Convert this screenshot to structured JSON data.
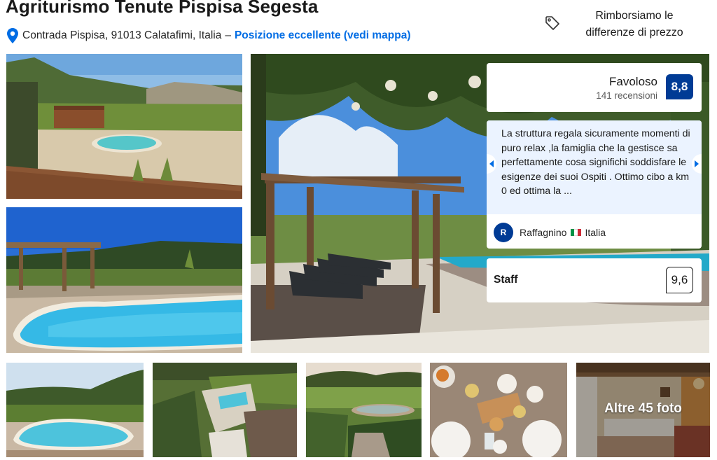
{
  "header": {
    "title": "Agriturismo Tenute Pispisa Segesta",
    "address": "Contrada Pispisa, 91013 Calatafimi, Italia",
    "separator": "–",
    "location_link": "Posizione eccellente (vedi mappa)"
  },
  "price_match": {
    "icon": "tag-icon",
    "text": "Rimborsiamo le differenze di prezzo"
  },
  "gallery": {
    "more_photos_label": "Altre 45 foto"
  },
  "rating": {
    "word": "Favoloso",
    "review_count": "141 recensioni",
    "score": "8,8"
  },
  "review": {
    "text": "La struttura regala sicuramente momenti di puro relax ,la famiglia che la gestisce sa perfettamente cosa significhi soddisfare le esigenze dei suoi Ospiti . Ottimo cibo a km 0 ed ottima la ...",
    "author_initial": "R",
    "author": "Raffagnino",
    "country": "Italia"
  },
  "staff": {
    "label": "Staff",
    "score": "9,6"
  },
  "colors": {
    "brand_blue": "#003b95",
    "link_blue": "#006ce4",
    "review_bg": "#ebf3ff"
  }
}
